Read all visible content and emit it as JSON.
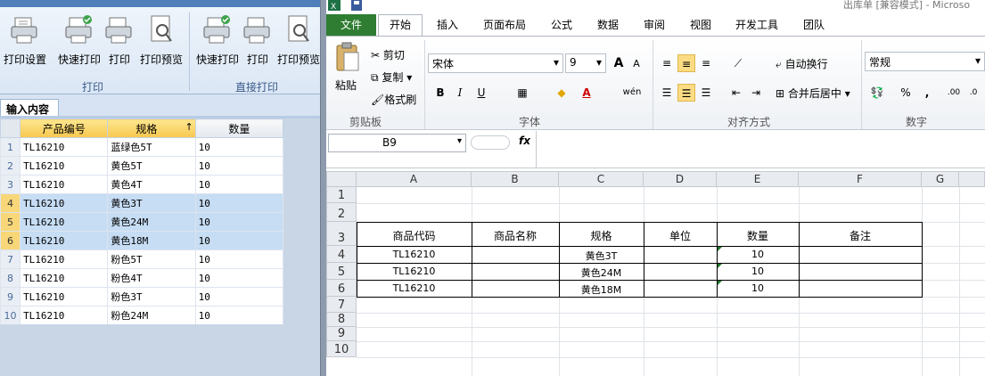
{
  "left_app": {
    "ribbon": {
      "buttons": {
        "print_settings": "打印设置",
        "quick_print_1": "快速打印",
        "print_1": "打印",
        "print_preview_1": "打印预览",
        "quick_print_2": "快速打印",
        "print_2": "打印",
        "print_preview_2": "打印预览"
      },
      "groups": {
        "print": "打印",
        "direct_print": "直接打印"
      }
    },
    "subtab": "输入内容",
    "grid": {
      "headers": {
        "code": "产品编号",
        "spec": "规格",
        "qty": "数量",
        "sort_arrow": "↑"
      },
      "rows": [
        {
          "n": "1",
          "code": "TL16210",
          "spec": "蓝绿色5T",
          "qty": "10"
        },
        {
          "n": "2",
          "code": "TL16210",
          "spec": "黄色5T",
          "qty": "10"
        },
        {
          "n": "3",
          "code": "TL16210",
          "spec": "黄色4T",
          "qty": "10"
        },
        {
          "n": "4",
          "code": "TL16210",
          "spec": "黄色3T",
          "qty": "10"
        },
        {
          "n": "5",
          "code": "TL16210",
          "spec": "黄色24M",
          "qty": "10"
        },
        {
          "n": "6",
          "code": "TL16210",
          "spec": "黄色18M",
          "qty": "10"
        },
        {
          "n": "7",
          "code": "TL16210",
          "spec": "粉色5T",
          "qty": "10"
        },
        {
          "n": "8",
          "code": "TL16210",
          "spec": "粉色4T",
          "qty": "10"
        },
        {
          "n": "9",
          "code": "TL16210",
          "spec": "粉色3T",
          "qty": "10"
        },
        {
          "n": "10",
          "code": "TL16210",
          "spec": "粉色24M",
          "qty": "10"
        }
      ]
    }
  },
  "excel": {
    "title": "出库单 [兼容模式] - Microso",
    "tabs": {
      "file": "文件",
      "home": "开始",
      "insert": "插入",
      "layout": "页面布局",
      "formula": "公式",
      "data": "数据",
      "review": "审阅",
      "view": "视图",
      "dev": "开发工具",
      "team": "团队"
    },
    "ribbon": {
      "paste": "粘贴",
      "cut": "剪切",
      "copy": "复制",
      "format_painter": "格式刷",
      "clipboard": "剪贴板",
      "font_name": "宋体",
      "font_size": "9",
      "font_group": "字体",
      "wrap": "自动换行",
      "merge": "合并后居中",
      "align_group": "对齐方式",
      "number_format": "常规",
      "number_group": "数字",
      "bold": "B",
      "italic": "I",
      "underline": "U",
      "grow": "A",
      "shrink": "A",
      "wen": "wén",
      "percent": "%",
      "comma": ","
    },
    "name_box": "B9",
    "fx": "fx",
    "columns": [
      "A",
      "B",
      "C",
      "D",
      "E",
      "F",
      "G"
    ],
    "row_numbers": [
      "1",
      "2",
      "3",
      "4",
      "5",
      "6",
      "7",
      "8",
      "9",
      "10"
    ],
    "table": {
      "headers": [
        "商品代码",
        "商品名称",
        "规格",
        "单位",
        "数量",
        "备注"
      ],
      "rows": [
        {
          "code": "TL16210",
          "spec": "黄色3T",
          "qty": "10"
        },
        {
          "code": "TL16210",
          "spec": "黄色24M",
          "qty": "10"
        },
        {
          "code": "TL16210",
          "spec": "黄色18M",
          "qty": "10"
        }
      ]
    },
    "colors": {
      "file_tab": "#2e7d32",
      "selected_row": "#c6ddf4",
      "highlight": "#fbdc84"
    }
  }
}
